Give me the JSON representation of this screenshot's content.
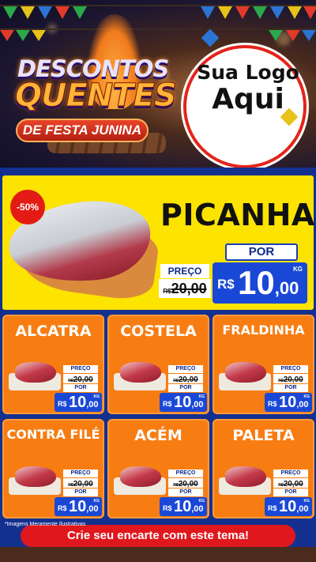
{
  "header": {
    "title_line1": "DESCONTOS",
    "title_line2": "QUENTES",
    "banner": "DE FESTA JUNINA",
    "logo_line1": "Sua Logo",
    "logo_line2": "Aqui"
  },
  "featured": {
    "badge": "-50%",
    "name": "PICANHA",
    "preco_label": "PREÇO",
    "por_label": "POR",
    "old_currency": "R$",
    "old_price": "20,00",
    "new_currency": "R$",
    "new_int": "10",
    "new_cents": ",00",
    "unit": "KG"
  },
  "cards": [
    {
      "name": "ALCATRA",
      "preco_label": "PREÇO",
      "old_currency": "R$",
      "old_price": "20,00",
      "por_label": "POR",
      "new_currency": "R$",
      "new_int": "10",
      "new_cents": ",00",
      "unit": "KG"
    },
    {
      "name": "COSTELA",
      "preco_label": "PREÇO",
      "old_currency": "R$",
      "old_price": "20,00",
      "por_label": "POR",
      "new_currency": "R$",
      "new_int": "10",
      "new_cents": ",00",
      "unit": "KG"
    },
    {
      "name": "FRALDINHA",
      "preco_label": "PREÇO",
      "old_currency": "R$",
      "old_price": "20,00",
      "por_label": "POR",
      "new_currency": "R$",
      "new_int": "10",
      "new_cents": ",00",
      "unit": "KG"
    },
    {
      "name": "CONTRA FILÉ",
      "preco_label": "PREÇO",
      "old_currency": "R$",
      "old_price": "20,00",
      "por_label": "POR",
      "new_currency": "R$",
      "new_int": "10",
      "new_cents": ",00",
      "unit": "KG"
    },
    {
      "name": "ACÉM",
      "preco_label": "PREÇO",
      "old_currency": "R$",
      "old_price": "20,00",
      "por_label": "POR",
      "new_currency": "R$",
      "new_int": "10",
      "new_cents": ",00",
      "unit": "KG"
    },
    {
      "name": "PALETA",
      "preco_label": "PREÇO",
      "old_currency": "R$",
      "old_price": "20,00",
      "por_label": "POR",
      "new_currency": "R$",
      "new_int": "10",
      "new_cents": ",00",
      "unit": "KG"
    }
  ],
  "footer": {
    "disclaimer": "*Imagens Meramente Ilustrativas",
    "cta": "Crie seu encarte com este tema!"
  },
  "colors": {
    "background": "#14308f",
    "featured_bg": "#fde300",
    "card_bg": "#f77d13",
    "price_bg": "#1a48d6",
    "badge_bg": "#e31b14",
    "cta_bg": "#e0181e"
  }
}
